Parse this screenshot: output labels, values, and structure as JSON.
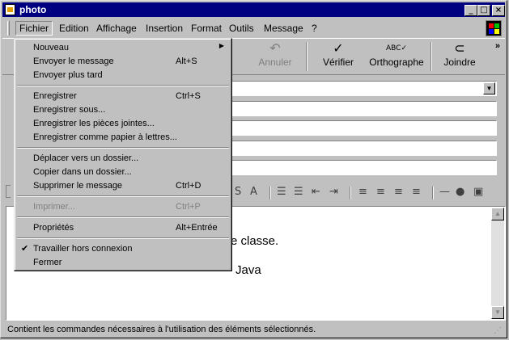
{
  "window": {
    "title": "photo"
  },
  "menubar": {
    "items": [
      "Fichier",
      "Edition",
      "Affichage",
      "Insertion",
      "Format",
      "Outils",
      "Message",
      "?"
    ]
  },
  "toolbar": {
    "buttons": [
      {
        "label": "Annuler",
        "icon": "undo-icon",
        "enabled": false
      },
      {
        "label": "Vérifier",
        "icon": "check-names-icon",
        "enabled": true
      },
      {
        "label": "Orthographe",
        "icon": "spelling-icon",
        "enabled": true
      },
      {
        "label": "Joindre",
        "icon": "paperclip-icon",
        "enabled": true
      }
    ],
    "more": "»"
  },
  "menu": {
    "items": [
      {
        "label": "Nouveau",
        "shortcut": "",
        "submenu": true,
        "enabled": true
      },
      {
        "label": "Envoyer le message",
        "shortcut": "Alt+S",
        "enabled": true
      },
      {
        "label": "Envoyer plus tard",
        "shortcut": "",
        "enabled": true
      },
      {
        "label": "Enregistrer",
        "shortcut": "Ctrl+S",
        "enabled": true
      },
      {
        "label": "Enregistrer sous...",
        "shortcut": "",
        "enabled": true
      },
      {
        "label": "Enregistrer les pièces jointes...",
        "shortcut": "",
        "enabled": true
      },
      {
        "label": "Enregistrer comme papier à lettres...",
        "shortcut": "",
        "enabled": true
      },
      {
        "label": "Déplacer vers un dossier...",
        "shortcut": "",
        "enabled": true
      },
      {
        "label": "Copier dans un dossier...",
        "shortcut": "",
        "enabled": true
      },
      {
        "label": "Supprimer le message",
        "shortcut": "Ctrl+D",
        "enabled": true
      },
      {
        "label": "Imprimer...",
        "shortcut": "Ctrl+P",
        "enabled": false
      },
      {
        "label": "Propriétés",
        "shortcut": "Alt+Entrée",
        "enabled": true
      },
      {
        "label": "Travailler hors connexion",
        "shortcut": "",
        "checked": true,
        "enabled": true
      },
      {
        "label": "Fermer",
        "shortcut": "",
        "enabled": true
      }
    ]
  },
  "body": {
    "line1": "e classe.",
    "line2": "Java"
  },
  "status": {
    "text": "Contient les commandes nécessaires à l'utilisation des éléments sélectionnés."
  },
  "colors": {
    "titlebar": "#000080",
    "face": "#c0c0c0",
    "disabled": "#808080"
  }
}
